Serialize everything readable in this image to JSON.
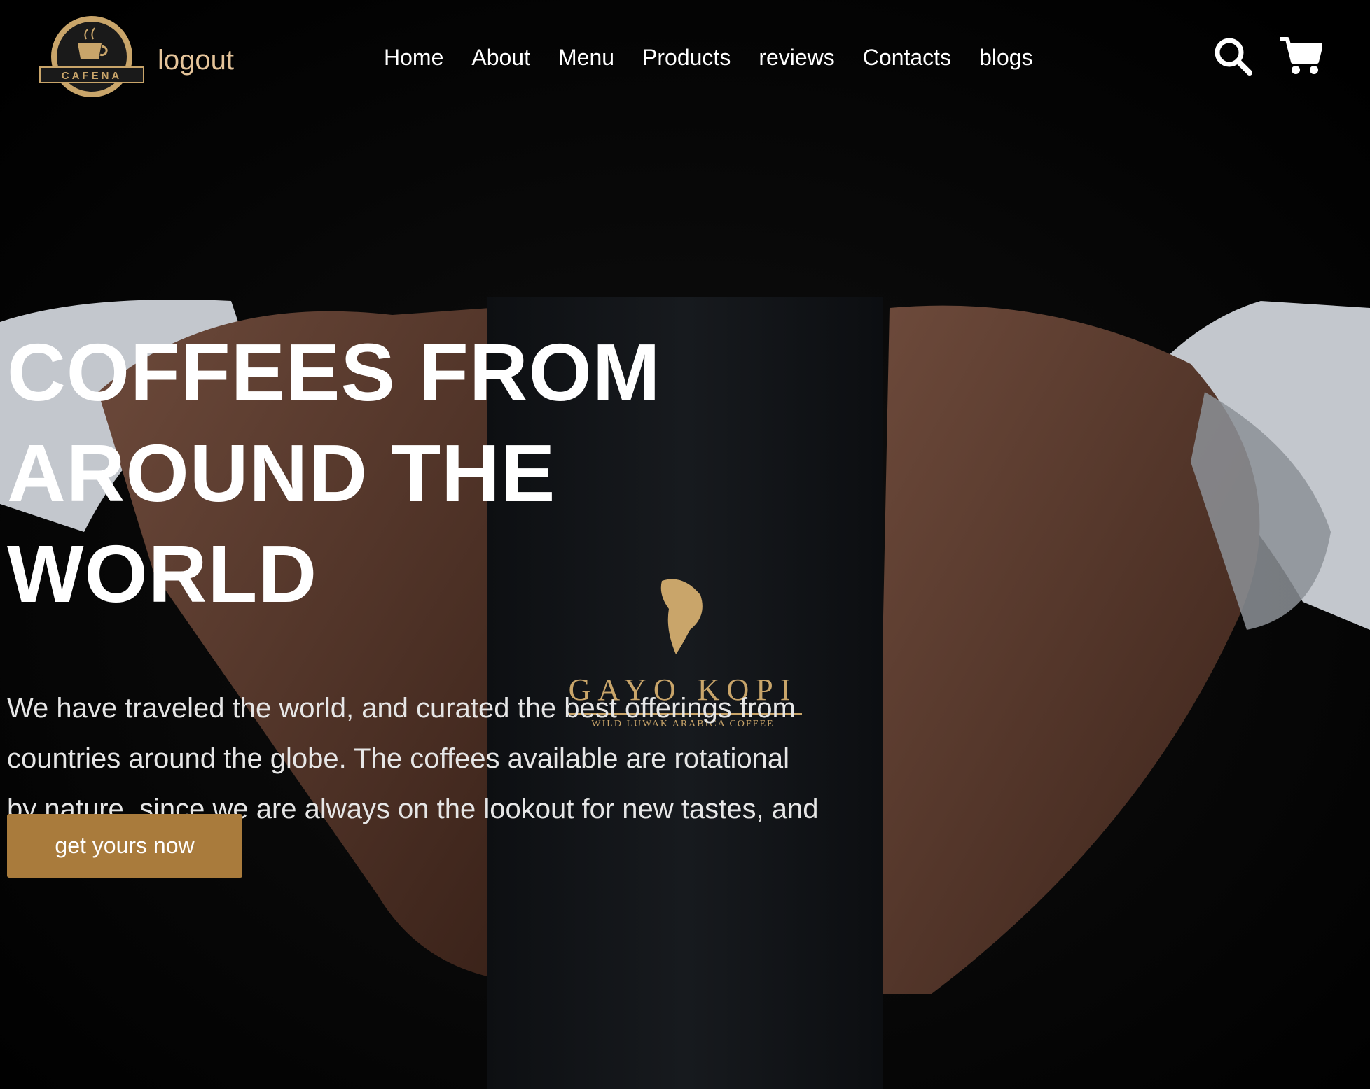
{
  "header": {
    "logo_text": "CAFENA",
    "logout_label": "logout",
    "nav": [
      "Home",
      "About",
      "Menu",
      "Products",
      "reviews",
      "Contacts",
      "blogs"
    ]
  },
  "hero": {
    "title_line1": "COFFEES FROM",
    "title_line2": "AROUND THE WORLD",
    "description": "We have traveled the world, and curated the best offerings from countries around the globe. The coffees available are rotational by nature, since we are always on the lookout for new tastes, and experiences.",
    "cta_label": "get yours now"
  },
  "product": {
    "brand": "GAYO KOPI",
    "tagline": "WILD LUWAK ARABICA COFFEE"
  },
  "colors": {
    "accent": "#a97b3c",
    "logout_text": "#e5c49a",
    "background": "#000000"
  },
  "icons": [
    "search-icon",
    "cart-icon",
    "logo-icon"
  ]
}
